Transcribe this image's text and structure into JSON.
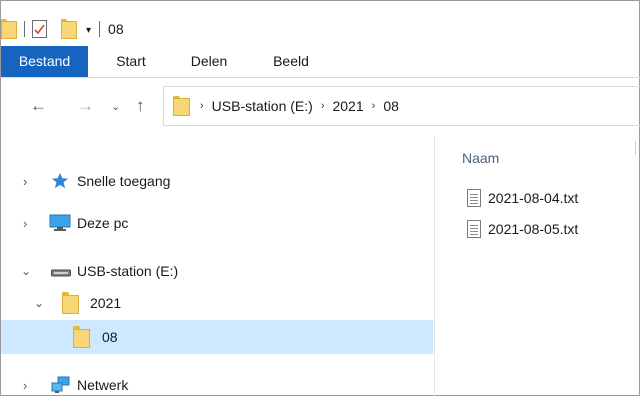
{
  "window": {
    "title": "08"
  },
  "ribbon": {
    "tabs": [
      {
        "label": "Bestand",
        "active": true
      },
      {
        "label": "Start",
        "active": false
      },
      {
        "label": "Delen",
        "active": false
      },
      {
        "label": "Beeld",
        "active": false
      }
    ]
  },
  "address": {
    "breadcrumbs": [
      "USB-station (E:)",
      "2021",
      "08"
    ]
  },
  "nav": {
    "items": [
      {
        "label": "Snelle toegang",
        "icon": "star-icon",
        "expanded": false
      },
      {
        "label": "Deze pc",
        "icon": "monitor-icon",
        "expanded": false
      },
      {
        "label": "USB-station (E:)",
        "icon": "usb-drive-icon",
        "expanded": true
      },
      {
        "label": "2021",
        "icon": "folder-icon",
        "expanded": true
      },
      {
        "label": "08",
        "icon": "folder-icon",
        "selected": true
      },
      {
        "label": "Netwerk",
        "icon": "network-icon",
        "expanded": false
      }
    ]
  },
  "content": {
    "column_header": "Naam",
    "files": [
      {
        "name": "2021-08-04.txt",
        "icon": "text-file-icon"
      },
      {
        "name": "2021-08-05.txt",
        "icon": "text-file-icon"
      }
    ]
  },
  "colors": {
    "accent": "#1565c0",
    "selection": "#cde8ff",
    "folder": "#f8d675"
  }
}
